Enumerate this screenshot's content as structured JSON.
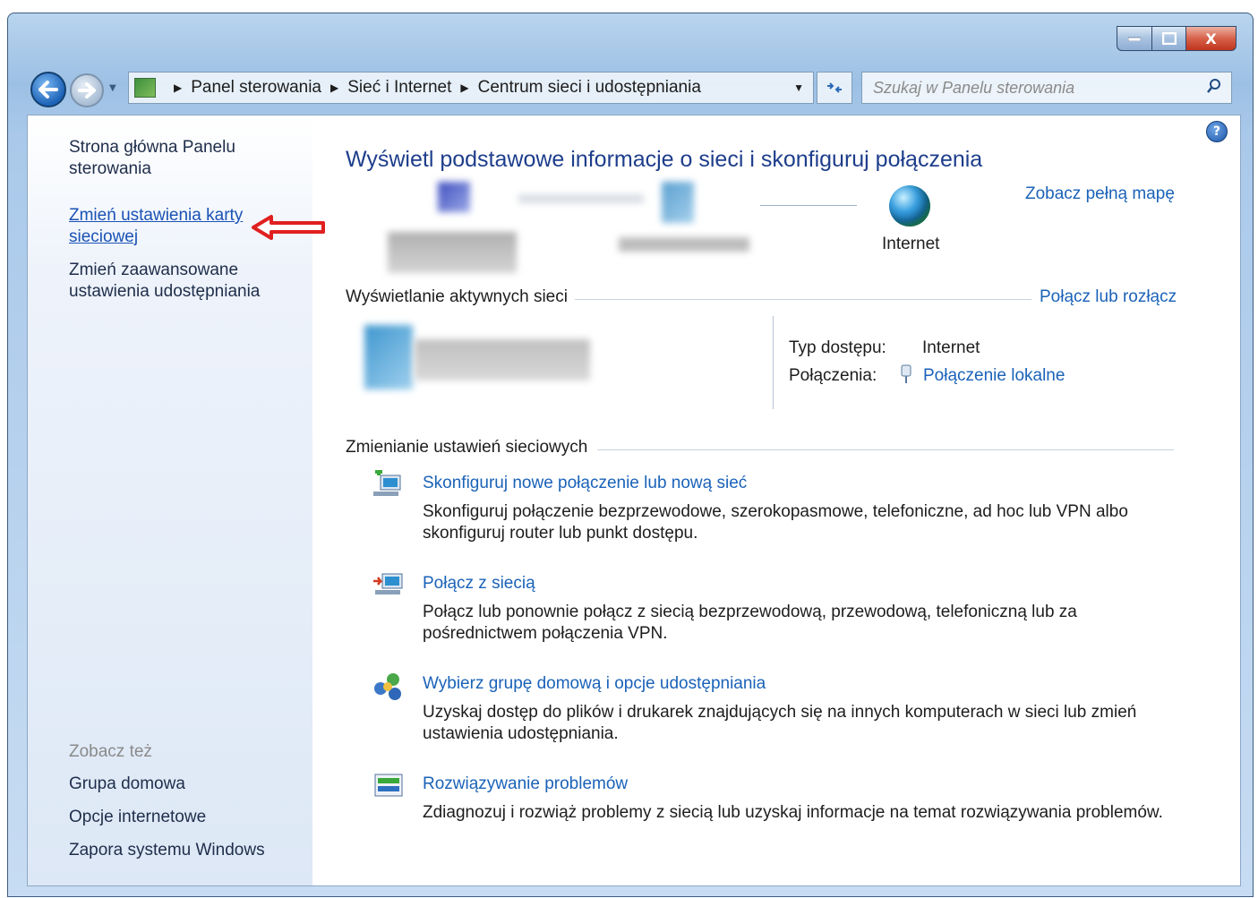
{
  "window": {
    "min_icon": "minimize-icon",
    "max_icon": "maximize-icon",
    "close_icon": "close-icon",
    "close_glyph": "X"
  },
  "address": {
    "crumbs": [
      "Panel sterowania",
      "Sieć i Internet",
      "Centrum sieci i udostępniania"
    ]
  },
  "search": {
    "placeholder": "Szukaj w Panelu sterowania"
  },
  "sidebar": {
    "home": "Strona główna Panelu sterowania",
    "change_adapter": "Zmień ustawienia karty sieciowej",
    "change_advanced": "Zmień zaawansowane ustawienia udostępniania",
    "see_also": "Zobacz też",
    "links": [
      "Grupa domowa",
      "Opcje internetowe",
      "Zapora systemu Windows"
    ]
  },
  "main": {
    "title": "Wyświetl podstawowe informacje o sieci i skonfiguruj połączenia",
    "see_full_map": "Zobacz pełną mapę",
    "internet_label": "Internet",
    "active_networks": "Wyświetlanie aktywnych sieci",
    "connect_disconnect": "Połącz lub rozłącz",
    "access_type_label": "Typ dostępu:",
    "access_type_value": "Internet",
    "connections_label": "Połączenia:",
    "connections_value": "Połączenie lokalne",
    "change_settings": "Zmienianie ustawień sieciowych",
    "tasks": [
      {
        "title": "Skonfiguruj nowe połączenie lub nową sieć",
        "desc": "Skonfiguruj połączenie bezprzewodowe, szerokopasmowe, telefoniczne, ad hoc lub VPN albo skonfiguruj router lub punkt dostępu."
      },
      {
        "title": "Połącz z siecią",
        "desc": "Połącz lub ponownie połącz z siecią bezprzewodową, przewodową, telefoniczną lub za pośrednictwem połączenia VPN."
      },
      {
        "title": "Wybierz grupę domową i opcje udostępniania",
        "desc": "Uzyskaj dostęp do plików i drukarek znajdujących się na innych komputerach w sieci lub zmień ustawienia udostępniania."
      },
      {
        "title": "Rozwiązywanie problemów",
        "desc": "Zdiagnozuj i rozwiąż problemy z siecią lub uzyskaj informacje na temat rozwiązywania problemów."
      }
    ]
  },
  "colors": {
    "link": "#1a62b8",
    "title": "#1e3e8c",
    "annotation_arrow": "#e02020"
  }
}
